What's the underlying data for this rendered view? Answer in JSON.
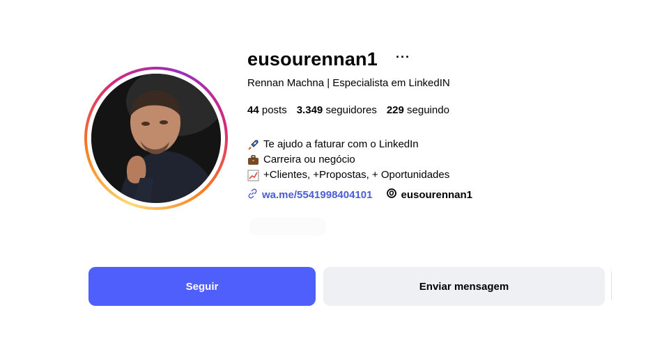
{
  "profile": {
    "username": "eusourennan1",
    "more_icon": "more-horizontal-icon",
    "full_name": "Rennan Machna | Especialista em LinkedIN",
    "stats": {
      "posts_count": "44",
      "posts_label": "posts",
      "followers_count": "3.349",
      "followers_label": "seguidores",
      "following_count": "229",
      "following_label": "seguindo"
    },
    "bio": [
      {
        "icon": "rocket-icon",
        "text": "Te ajudo a faturar com o LinkedIn"
      },
      {
        "icon": "briefcase-icon",
        "text": "Carreira ou negócio"
      },
      {
        "icon": "chart-increasing-icon",
        "text": "+Clientes, +Propostas, + Oportunidades"
      }
    ],
    "link": {
      "icon": "link-icon",
      "text": "wa.me/5541998404101"
    },
    "threads": {
      "icon": "threads-icon",
      "text": "eusourennan1"
    }
  },
  "actions": {
    "follow_label": "Seguir",
    "message_label": "Enviar mensagem"
  },
  "colors": {
    "accent": "#4f5ffb",
    "link": "#4a5cd6",
    "secondary_button": "#eff0f4"
  }
}
